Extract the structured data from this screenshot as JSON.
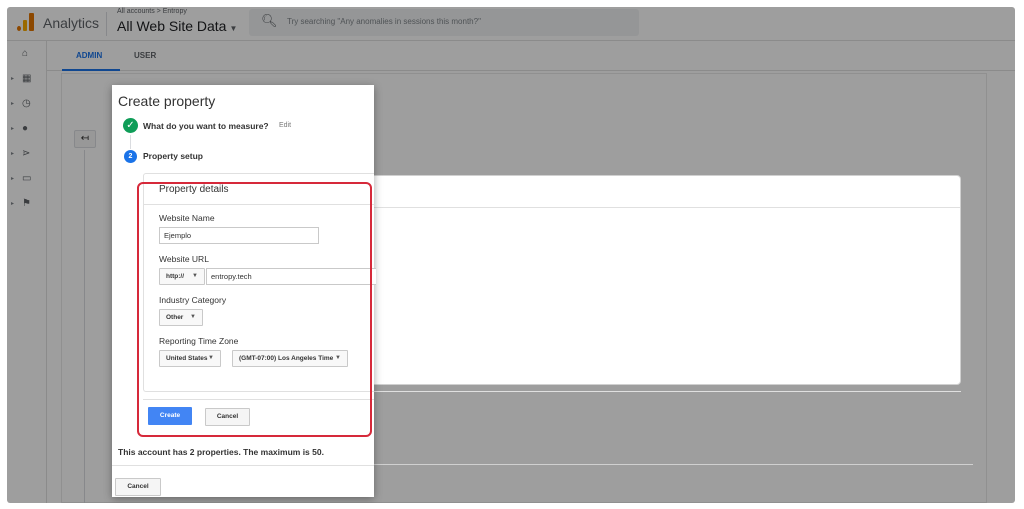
{
  "header": {
    "app_name": "Analytics",
    "breadcrumb": "All accounts > Entropy",
    "view_name": "All Web Site Data",
    "view_caret": "▼",
    "search_placeholder": "Try searching \"Any anomalies in sessions this month?\"",
    "search_icon": "search-icon"
  },
  "sidebar": {
    "items": [
      {
        "icon": "home-icon",
        "glyph": "⌂"
      },
      {
        "icon": "dashboard-icon",
        "glyph": "▦"
      },
      {
        "icon": "clock-icon",
        "glyph": "◷"
      },
      {
        "icon": "person-icon",
        "glyph": "●"
      },
      {
        "icon": "acquisition-icon",
        "glyph": "⋗"
      },
      {
        "icon": "behavior-icon",
        "glyph": "▭"
      },
      {
        "icon": "flag-icon",
        "glyph": "⚑"
      }
    ],
    "expand_glyph": "▸"
  },
  "tabs": {
    "admin": "ADMIN",
    "user": "USER"
  },
  "back_glyph": "↤",
  "dialog": {
    "title": "Create property",
    "step1": {
      "check_glyph": "✓",
      "label": "What do you want to measure?",
      "edit": "Edit"
    },
    "step2": {
      "number": "2",
      "label": "Property setup"
    },
    "details": {
      "heading": "Property details",
      "website_name_label": "Website Name",
      "website_name_value": "Ejemplo",
      "website_url_label": "Website URL",
      "protocol_value": "http://",
      "url_value": "entropy.tech",
      "industry_label": "Industry Category",
      "industry_value": "Other",
      "timezone_label": "Reporting Time Zone",
      "country_value": "United States",
      "timezone_value": "(GMT-07:00) Los Angeles Time"
    },
    "create_button": "Create",
    "cancel_button": "Cancel",
    "account_note": "This account has 2 properties. The maximum is 50.",
    "footer_cancel": "Cancel"
  },
  "colors": {
    "accent": "#1a73e8",
    "success": "#0f9d58",
    "create_button": "#4285f4",
    "highlight": "#d6293a"
  }
}
